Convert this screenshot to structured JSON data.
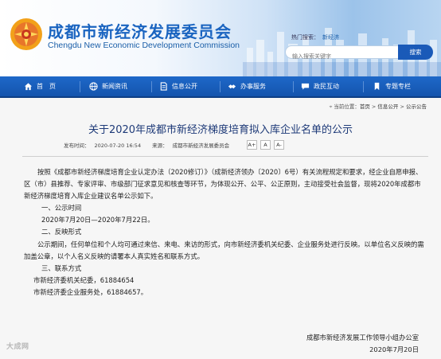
{
  "header": {
    "title_cn": "成都市新经济发展委员会",
    "title_en": "Chengdu New Economic Development Commission",
    "hot_search_label": "热门搜索：",
    "hot_search_keyword": "新经济",
    "search_placeholder": "输入搜索关键字",
    "search_button": "搜索"
  },
  "nav": {
    "items": [
      {
        "label": "首　页",
        "icon": "home-icon"
      },
      {
        "label": "新闻资讯",
        "icon": "globe-icon"
      },
      {
        "label": "信息公开",
        "icon": "document-icon"
      },
      {
        "label": "办事服务",
        "icon": "handshake-icon"
      },
      {
        "label": "政民互动",
        "icon": "chat-icon"
      },
      {
        "label": "专题专栏",
        "icon": "bookmark-icon"
      }
    ]
  },
  "breadcrumb": {
    "current_location": "当前位置：",
    "items": [
      "首页",
      "信息公开",
      "公示公告"
    ],
    "separator": " > "
  },
  "article": {
    "title": "关于2020年成都市新经济梯度培育拟入库企业名单的公示",
    "publish_label": "发布时间：",
    "publish_time": "2020-07-20 16:54",
    "source_label": "来源：",
    "source": "成都市新经济发展委员会",
    "font_large": "A+",
    "font_small": "A-",
    "font_print": "A",
    "paragraphs": [
      "按照《成都市新经济梯度培育企业认定办法（2020修订）》（成新经济领办〔2020〕6号）有关流程规定和要求，经企业自愿申报、区（市）县推荐、专家评审、市级部门征求意见和核查等环节，为体现公开、公平、公正原则，主动接受社会监督，现将2020年成都市新经济梯度培育入库企业建议名单公示如下。",
      "一、公示时间",
      "2020年7月20日—2020年7月22日。",
      "二、反映形式",
      "公示期间，任何单位和个人均可通过来信、来电、来访的形式，向市新经济委机关纪委、企业服务处进行反映。以单位名义反映的需加盖公章，以个人名义反映的请署本人真实姓名和联系方式。",
      "三、联系方式",
      "市新经济委机关纪委，61884654",
      "市新经济委企业服务处，61884657。"
    ],
    "signature_org": "成都市新经济发展工作领导小组办公室",
    "signature_date": "2020年7月20日"
  },
  "watermark": "大成网"
}
